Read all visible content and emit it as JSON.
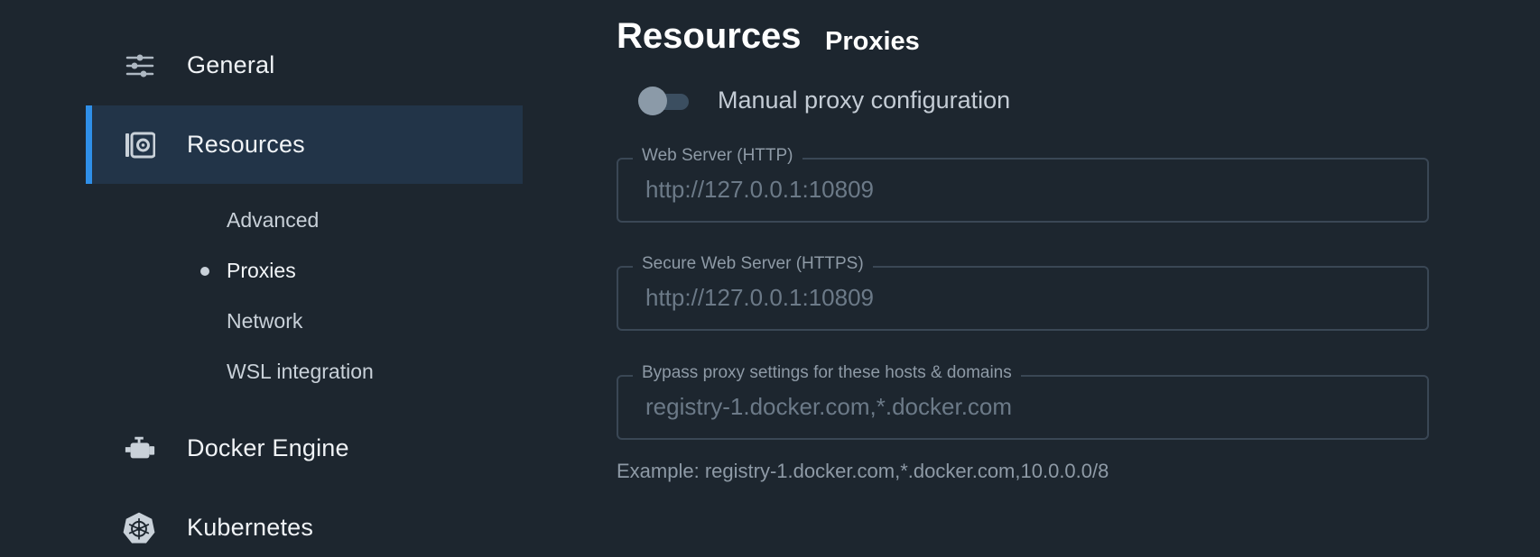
{
  "sidebar": {
    "items": [
      {
        "label": "General",
        "icon": "sliders-icon"
      },
      {
        "label": "Resources",
        "icon": "resources-icon",
        "active": true
      },
      {
        "label": "Docker Engine",
        "icon": "engine-icon"
      },
      {
        "label": "Kubernetes",
        "icon": "kubernetes-icon"
      }
    ],
    "sub_items": [
      {
        "label": "Advanced"
      },
      {
        "label": "Proxies",
        "selected": true
      },
      {
        "label": "Network"
      },
      {
        "label": "WSL integration"
      }
    ]
  },
  "main": {
    "title": "Resources",
    "subtitle": "Proxies",
    "toggle": {
      "label": "Manual proxy configuration",
      "on": false
    },
    "fields": [
      {
        "legend": "Web Server (HTTP)",
        "placeholder": "http://127.0.0.1:10809"
      },
      {
        "legend": "Secure Web Server (HTTPS)",
        "placeholder": "http://127.0.0.1:10809"
      },
      {
        "legend": "Bypass proxy settings for these hosts & domains",
        "placeholder": "registry-1.docker.com,*.docker.com"
      }
    ],
    "hint": "Example: registry-1.docker.com,*.docker.com,10.0.0.0/8"
  },
  "colors": {
    "background": "#1d262f",
    "active_bg": "#223448",
    "accent": "#2f8fe8"
  }
}
